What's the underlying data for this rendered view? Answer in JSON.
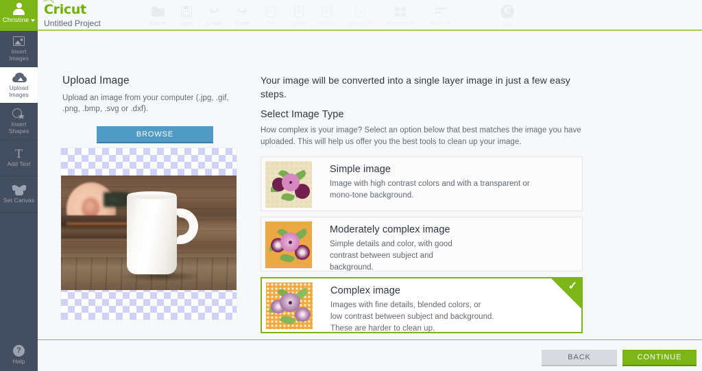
{
  "brand": {
    "logo": "Cricut",
    "project": "Untitled Project"
  },
  "user": {
    "name": "Christine",
    "avatar_icon": "user-avatar-icon"
  },
  "toolbar": [
    {
      "label": "File",
      "icon": "folder-icon",
      "dropdown": true,
      "disabled": false
    },
    {
      "label": "Save",
      "icon": "floppy-disk-icon",
      "dropdown": false,
      "disabled": false
    },
    {
      "label": "Undo",
      "icon": "undo-arrow-icon",
      "dropdown": false,
      "disabled": false
    },
    {
      "label": "Redo",
      "icon": "redo-arrow-icon",
      "dropdown": false,
      "disabled": false
    },
    {
      "label": "Cut",
      "icon": "cut-document-icon",
      "dropdown": false,
      "disabled": true
    },
    {
      "label": "Copy",
      "icon": "copy-document-icon",
      "dropdown": false,
      "disabled": true
    },
    {
      "label": "Paste",
      "icon": "paste-document-icon",
      "dropdown": false,
      "disabled": true
    },
    {
      "label": "Select All",
      "icon": "select-all-icon",
      "dropdown": false,
      "disabled": true
    },
    {
      "label": "Arrange",
      "icon": "arrange-icon",
      "dropdown": true,
      "disabled": true
    },
    {
      "label": "Align",
      "icon": "align-icon",
      "dropdown": true,
      "disabled": true
    },
    {
      "label": "Go",
      "icon": "cricut-go-icon",
      "dropdown": false,
      "disabled": true
    }
  ],
  "sidebar": {
    "items": [
      {
        "label": "Insert\nImages",
        "icon": "insert-images-icon",
        "active": false
      },
      {
        "label": "Upload\nImages",
        "icon": "upload-cloud-icon",
        "active": true
      },
      {
        "label": "Insert\nShapes",
        "icon": "insert-shapes-icon",
        "active": false
      },
      {
        "label": "Add Text",
        "icon": "text-T-icon",
        "active": false
      },
      {
        "label": "Set Canvas",
        "icon": "t-shirt-icon",
        "active": false
      }
    ],
    "help": {
      "label": "Help",
      "icon": "question-mark-icon"
    }
  },
  "upload": {
    "title": "Upload Image",
    "description": "Upload an image from your computer (.jpg, .gif, .png, .bmp, .svg or .dxf).",
    "browse_label": "BROWSE",
    "preview_alt": "white coffee mug on wooden table with rose and book"
  },
  "image_type": {
    "lead": "Your image will be converted into a single layer image in just a few easy steps.",
    "heading": "Select Image Type",
    "subtext": "How complex is your image? Select an option below that best matches the image you have uploaded. This will help us offer you the best tools to clean up your image.",
    "options": [
      {
        "title": "Simple image",
        "description": "Image with high contrast colors and with a transparent or mono-tone background.",
        "selected": false,
        "thumb": "flat-flowers-cream-background"
      },
      {
        "title": "Moderately complex image",
        "description": "Simple details and color, with good contrast between subject and background.",
        "selected": false,
        "thumb": "detailed-flowers-orange-background"
      },
      {
        "title": "Complex image",
        "description": "Images with fine details, blended colors, or low contrast between subject and background. These are harder to clean up.",
        "selected": true,
        "thumb": "shaded-flowers-dotted-orange-background"
      }
    ],
    "check_glyph": "✓"
  },
  "footer": {
    "back_label": "BACK",
    "continue_label": "CONTINUE"
  },
  "colors": {
    "brand_green": "#7cb518",
    "header_rule": "#a9ce4f",
    "sidebar_bg": "#434f60",
    "browse_blue": "#4f9bc6",
    "back_gray": "#d7dade",
    "checker_lavender": "#cfd2f5"
  }
}
